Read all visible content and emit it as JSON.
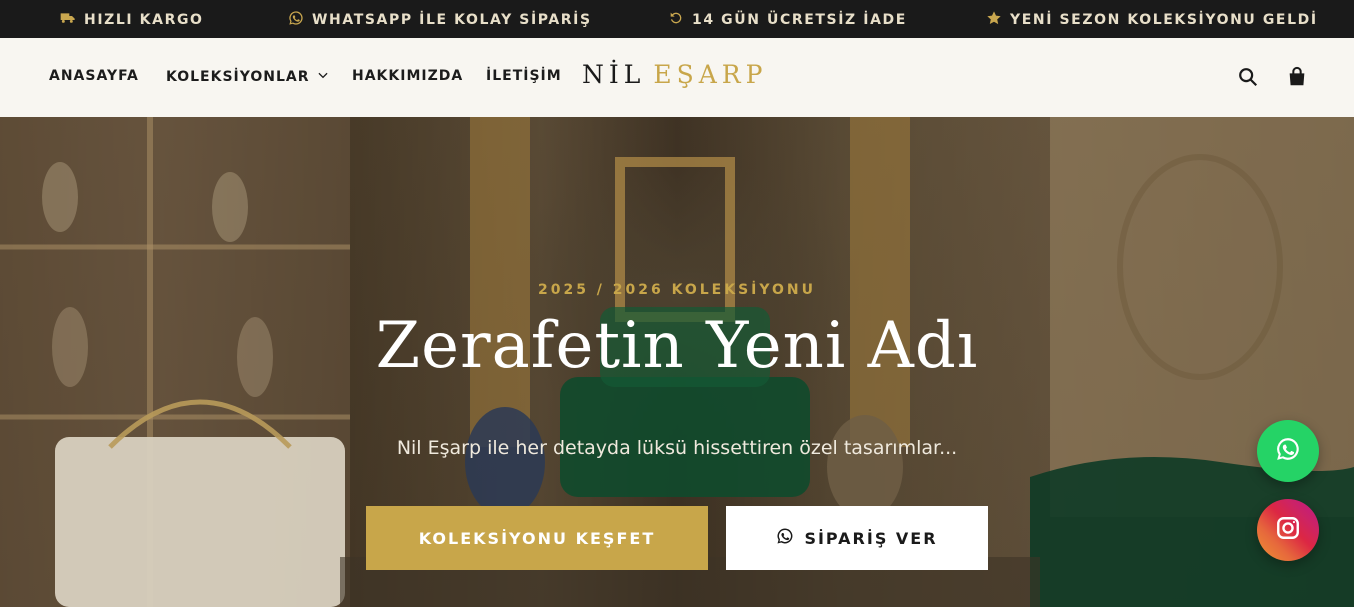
{
  "announcements": [
    {
      "icon": "truck-icon",
      "text": "HIZLI KARGO"
    },
    {
      "icon": "whatsapp-icon",
      "text": "WHATSAPP İLE KOLAY SİPARİŞ"
    },
    {
      "icon": "return-icon",
      "text": "14 GÜN ÜCRETSİZ İADE"
    },
    {
      "icon": "star-icon",
      "text": "YENİ SEZON KOLEKSİYONU GELDİ"
    }
  ],
  "nav": {
    "links": [
      {
        "label": "ANASAYFA"
      },
      {
        "label": "KOLEKSİYONLAR",
        "icon": "chevron-down-icon"
      },
      {
        "label": "HAKKIMIZDA"
      },
      {
        "label": "İLETİŞİM"
      }
    ],
    "logo_part1": "NİL",
    "logo_part2": "EŞARP",
    "icons": [
      "search-icon",
      "shopping-bag-icon"
    ]
  },
  "hero": {
    "subtitle": "2025 / 2026 KOLEKSİYONU",
    "title": "Zerafetin Yeni Adı",
    "description": "Nil Eşarp ile her detayda lüksü hissettiren özel tasarımlar...",
    "primary_button": "KOLEKSİYONU KEŞFET",
    "secondary_button": "SİPARİŞ VER"
  },
  "floating": [
    "whatsapp-icon",
    "instagram-icon"
  ],
  "colors": {
    "topbar_bg": "#1a1a1a",
    "nav_bg": "#f8f6f1",
    "gold": "#c8a64a",
    "whatsapp": "#25d366"
  }
}
